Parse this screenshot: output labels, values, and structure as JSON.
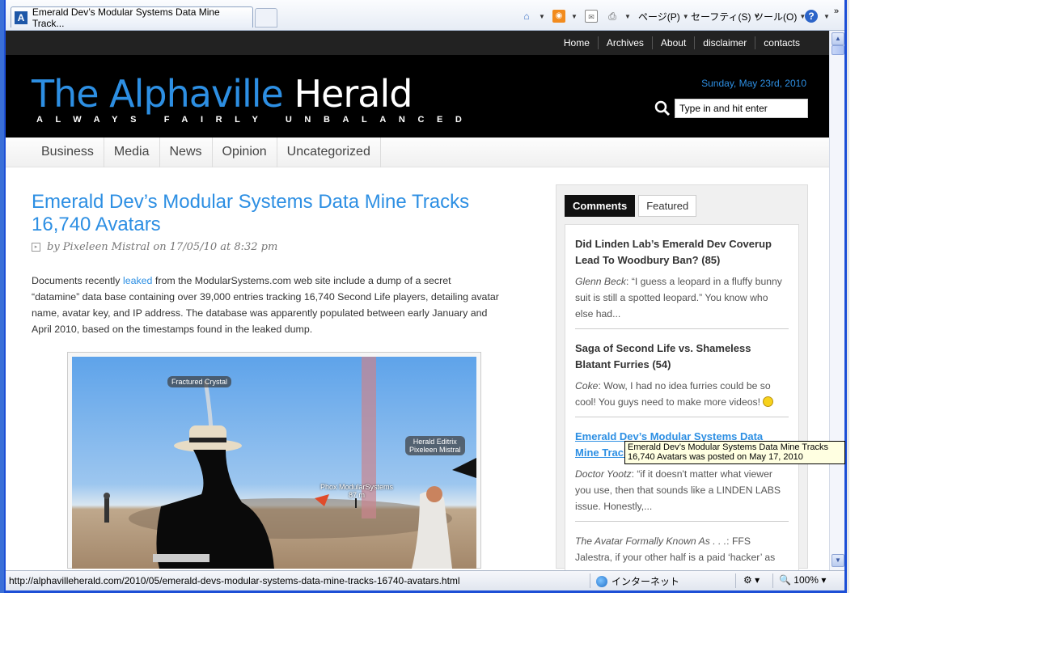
{
  "browser": {
    "tab_title": "Emerald Dev’s Modular Systems Data Mine Track...",
    "commands": {
      "page": "ページ(P)",
      "safety": "セーフティ(S)",
      "tools": "ツール(O)"
    }
  },
  "site": {
    "top_links": [
      "Home",
      "Archives",
      "About",
      "disclaimer",
      "contacts"
    ],
    "logo_part1": "The Alphaville",
    "logo_part2": "Herald",
    "tagline": "ALWAYS FAIRLY UNBALANCED",
    "date": "Sunday, May 23rd, 2010",
    "search_placeholder": "Type in and hit enter",
    "categories": [
      "Business",
      "Media",
      "News",
      "Opinion",
      "Uncategorized"
    ]
  },
  "post": {
    "title": "Emerald Dev’s Modular Systems Data Mine Tracks 16,740 Avatars",
    "byline": "by Pixeleen Mistral on 17/05/10 at 8:32 pm",
    "body_before_link": "Documents recently ",
    "body_link": "leaked",
    "body_after_link": " from the ModularSystems.com web site include a dump of a secret “datamine” data base containing over 39,000 entries tracking 16,740 Second Life players, detailing avatar name, avatar key, and IP address. The database was apparently populated between early January and April 2010, based on the timestamps found in the leaked dump.",
    "image_labels": {
      "label1": "Fractured Crystal",
      "label2_line1": "Herald Editrix",
      "label2_line2": "Pixeleen Mistral",
      "label3_line1": "Phox ModularSystems",
      "label3_line2": "87 m"
    }
  },
  "sidebar": {
    "tabs": [
      "Comments",
      "Featured"
    ],
    "items": [
      {
        "title": "Did Linden Lab’s Emerald Dev Coverup Lead To Woodbury Ban? (85)",
        "author": "Glenn Beck",
        "comment": ": “I guess a leopard in a fluffy bunny suit is still a spotted leopard.” You know who else had..."
      },
      {
        "title": "Saga of Second Life vs. Shameless Blatant Furries (54)",
        "author": "Coke",
        "comment": ": Wow, I had no idea furries could be so cool! You guys need to make more videos! "
      },
      {
        "title": "Emerald Dev’s Modular Systems Data Mine Track",
        "author": "Doctor Yootz",
        "comment": ": “if it doesn't matter what viewer you use, then that sounds like a LINDEN LABS issue. Honestly,..."
      },
      {
        "title": "",
        "author": "The Avatar Formally Known As . . .",
        "comment": ": FFS Jalestra, if your other half is a paid ‘hacker’ as you say, get..."
      }
    ]
  },
  "tooltip": {
    "line1": "Emerald Dev’s Modular Systems Data Mine Tracks",
    "line2": "16,740 Avatars was posted on May 17, 2010"
  },
  "status": {
    "url": "http://alphavilleherald.com/2010/05/emerald-devs-modular-systems-data-mine-tracks-16740-avatars.html",
    "zone": "インターネット",
    "zoom": "100%"
  }
}
